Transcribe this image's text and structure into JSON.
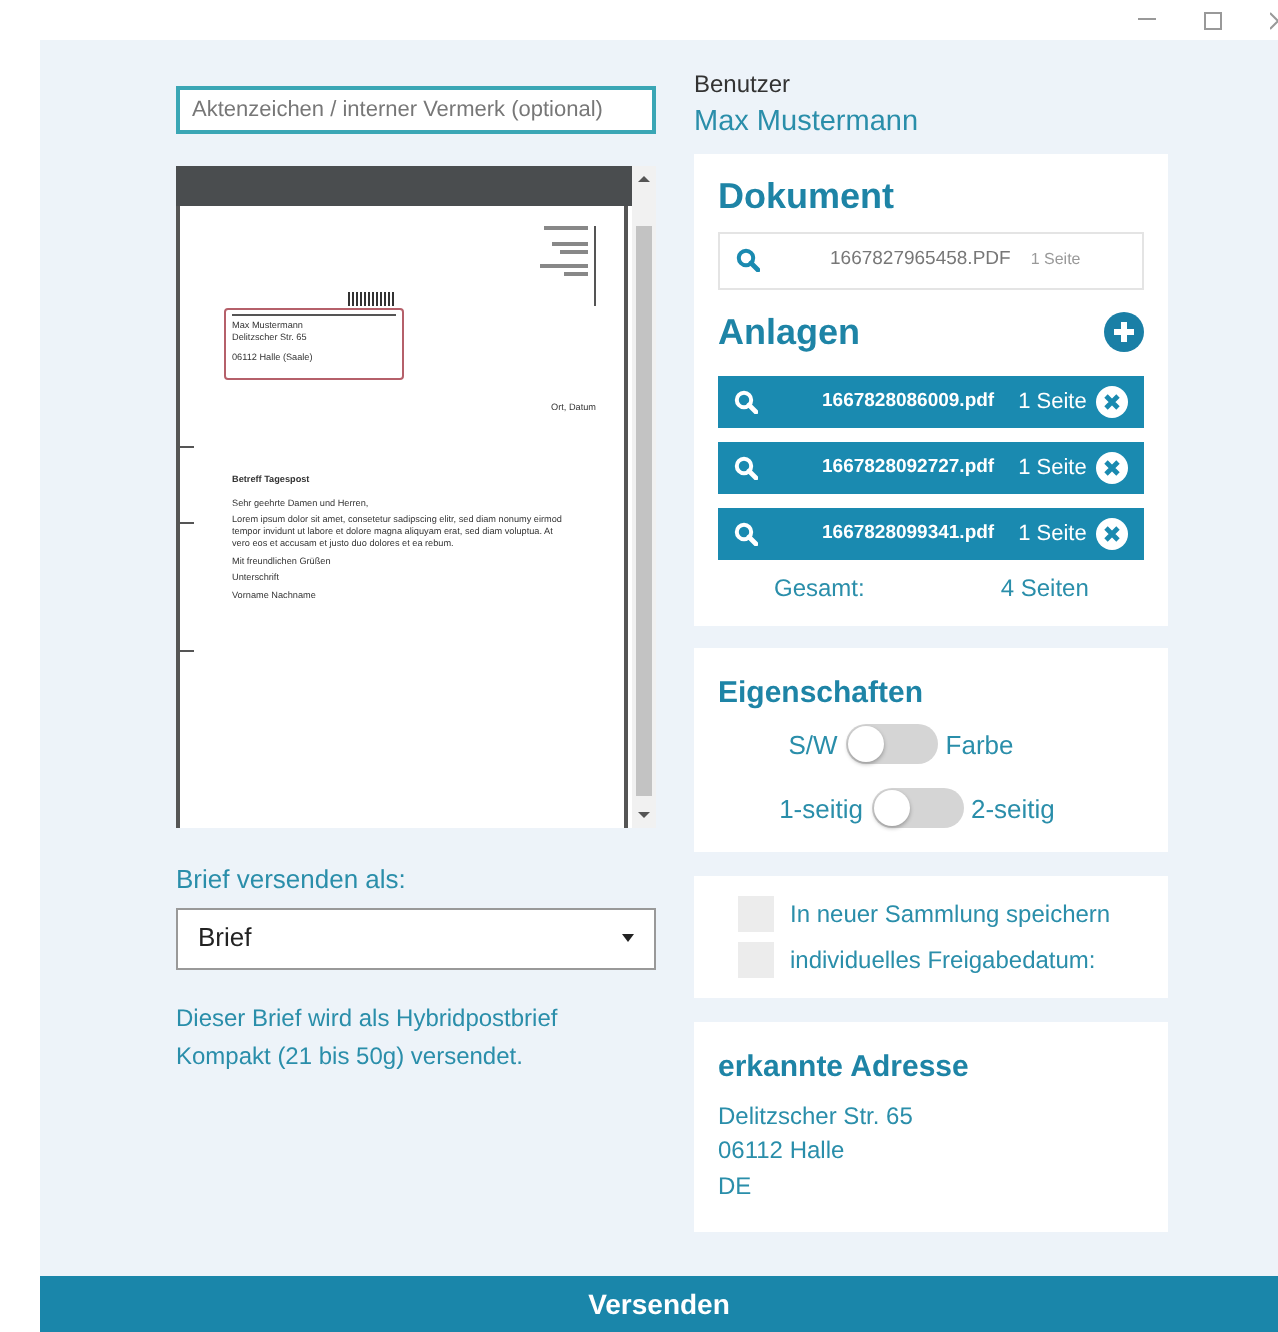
{
  "reference_field": {
    "placeholder": "Aktenzeichen / interner Vermerk (optional)"
  },
  "preview": {
    "recipient": [
      "Max Mustermann",
      "Delitzscher Str. 65",
      "06112 Halle (Saale)"
    ],
    "date_line": "Ort, Datum",
    "subject": "Betreff Tagespost",
    "body": [
      "Sehr geehrte Damen und Herren,",
      "Lorem ipsum dolor sit amet, consetetur sadipscing elitr, sed diam nonumy eirmod tempor invidunt ut labore et dolore magna aliquyam erat, sed diam voluptua. At vero eos et accusam et justo duo dolores et ea rebum.",
      "Mit freundlichen Grüßen",
      "Unterschrift",
      "Vorname Nachname"
    ]
  },
  "send_as": {
    "label": "Brief versenden als:",
    "value": "Brief"
  },
  "note": "Dieser Brief wird als Hybridpostbrief Kompakt (21 bis 50g) versendet.",
  "user": {
    "label": "Benutzer",
    "name": "Max Mustermann"
  },
  "document": {
    "title": "Dokument",
    "file": {
      "name": "1667827965458.PDF",
      "pages": "1 Seite"
    }
  },
  "attachments": {
    "title": "Anlagen",
    "items": [
      {
        "name": "1667828086009.pdf",
        "pages": "1 Seite"
      },
      {
        "name": "1667828092727.pdf",
        "pages": "1 Seite"
      },
      {
        "name": "1667828099341.pdf",
        "pages": "1 Seite"
      }
    ],
    "total": {
      "label": "Gesamt:",
      "value": "4 Seiten"
    }
  },
  "properties": {
    "title": "Eigenschaften",
    "toggles": [
      {
        "left": "S/W",
        "right": "Farbe",
        "on": false
      },
      {
        "left": "1-seitig",
        "right": "2-seitig",
        "on": false
      }
    ]
  },
  "options": [
    {
      "label": "In neuer Sammlung speichern",
      "checked": false
    },
    {
      "label": "individuelles Freigabedatum:",
      "checked": false
    }
  ],
  "address": {
    "title": "erkannte Adresse",
    "lines": [
      "Delitzscher Str. 65",
      "06112 Halle",
      "DE"
    ]
  },
  "submit": "Versenden"
}
